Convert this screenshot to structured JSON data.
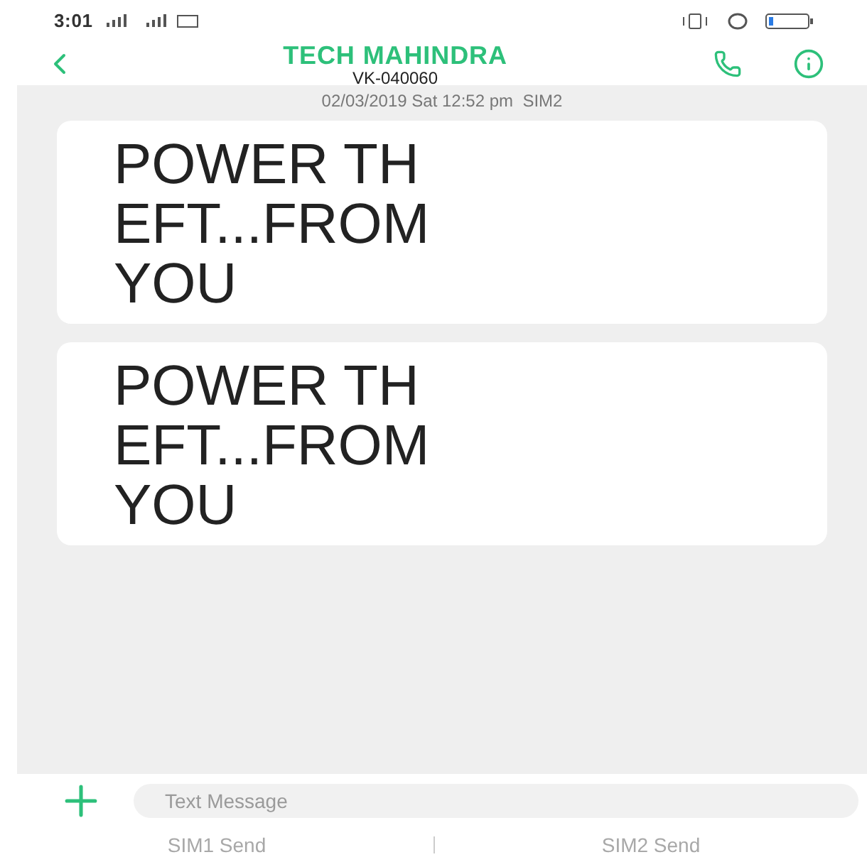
{
  "status_bar": {
    "time": "3:01"
  },
  "header": {
    "title": "TECH MAHINDRA",
    "subtitle": "VK-040060"
  },
  "timestamp": "02/03/2019 Sat 12:52 pm  SIM2",
  "messages": [
    {
      "lines": [
        "POWER TH",
        "EFT...FROM",
        "YOU"
      ]
    },
    {
      "lines": [
        "POWER TH",
        "EFT...FROM",
        "YOU"
      ]
    }
  ],
  "composer": {
    "placeholder": "Text Message"
  },
  "send_buttons": [
    {
      "label": "SIM1 Send",
      "disabled": true
    },
    {
      "label": "SIM2 Send",
      "disabled": true
    }
  ]
}
